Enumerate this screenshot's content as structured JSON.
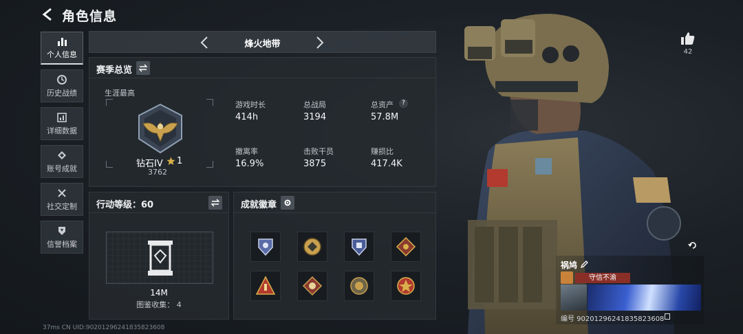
{
  "header": {
    "title": "角色信息"
  },
  "sidebar": {
    "items": [
      {
        "label": "个人信息",
        "icon": "bar-chart-icon",
        "active": true
      },
      {
        "label": "历史战绩",
        "icon": "clock-icon"
      },
      {
        "label": "详细数据",
        "icon": "chart-icon"
      },
      {
        "label": "账号成就",
        "icon": "medal-icon"
      },
      {
        "label": "社交定制",
        "icon": "tools-icon"
      },
      {
        "label": "信誉档案",
        "icon": "shield-icon"
      }
    ]
  },
  "mode_selector": {
    "name": "烽火地带"
  },
  "season": {
    "title": "赛季总览",
    "career_label": "生涯最高",
    "rank_name": "钻石IV",
    "rank_stars": "1",
    "rank_score": "3762",
    "stats": [
      {
        "label": "游戏时长",
        "value": "414h"
      },
      {
        "label": "总战局",
        "value": "3194"
      },
      {
        "label": "总资产",
        "value": "57.8M"
      },
      {
        "label": "撤离率",
        "value": "16.9%"
      },
      {
        "label": "击败干员",
        "value": "3875"
      },
      {
        "label": "赚损比",
        "value": "417.4K"
      }
    ],
    "help_symbol": "?"
  },
  "action_level": {
    "title": "行动等级：60",
    "value": "14M",
    "collection": "图鉴收集： 4"
  },
  "achievements": {
    "title": "成就徽章",
    "badges": [
      "badge-icon",
      "badge-icon",
      "badge-icon",
      "badge-icon",
      "badge-icon",
      "badge-icon",
      "badge-icon",
      "badge-icon"
    ]
  },
  "likes": {
    "count": "42"
  },
  "player_card": {
    "name": "祸鸠",
    "rank_text": "守信不渝",
    "id_text": "编号 902012962418358236​08"
  },
  "status_bar": {
    "text": "37ms    CN UID:902012962418358236​08"
  },
  "colors": {
    "accent": "#d8b04a",
    "rank_red": "#8a2f28",
    "panel": "#262b30"
  }
}
